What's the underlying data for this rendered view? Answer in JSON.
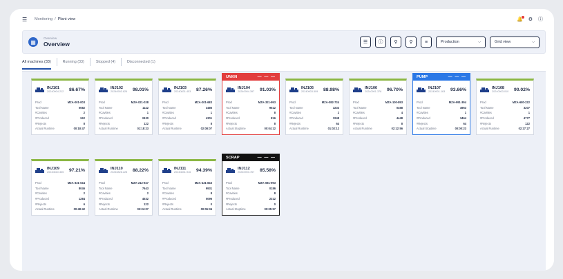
{
  "topbar": {
    "breadcrumb_root": "Monitoring",
    "breadcrumb_sep": "/",
    "breadcrumb_current": "Plant view"
  },
  "header": {
    "subtitle": "Overview",
    "title": "Overview",
    "mode_select": "Production",
    "view_select": "Grid view"
  },
  "tabs": [
    {
      "label": "All machines (33)"
    },
    {
      "label": "Running (33)"
    },
    {
      "label": "Stopped (4)"
    },
    {
      "label": "Disconnected (1)"
    }
  ],
  "row_labels": {
    "prod": "Prod",
    "tool": "Tool Name",
    "cavities": "#Cavities",
    "produced": "#Produced",
    "rejects": "#Rejects",
    "runtime": "Actual Runtime",
    "stoptime": "Actual Stoptime"
  },
  "machines": [
    {
      "name": "INJ101",
      "date": "20240904.212",
      "pct": "86.67%",
      "prod": "MZA-001-003",
      "tool": "0082",
      "cavities": "2",
      "produced": "242",
      "rejects": "8",
      "time": "00:18:47",
      "alert": "",
      "time_label": "runtime"
    },
    {
      "name": "INJ102",
      "date": "20240903.826",
      "pct": "98.01%",
      "prod": "MZA-021-038",
      "tool": "1142",
      "cavities": "1",
      "produced": "2430",
      "rejects": "122",
      "time": "01:18:23",
      "alert": "",
      "time_label": "runtime"
    },
    {
      "name": "INJ103",
      "date": "20240831.453",
      "pct": "87.26%",
      "prod": "MZA-201-683",
      "tool": "3486",
      "cavities": "1",
      "produced": "4301",
      "rejects": "8",
      "time": "02:08:07",
      "alert": "",
      "time_label": "runtime"
    },
    {
      "name": "INJ104",
      "date": "20240904.397",
      "pct": "91.03%",
      "prod": "MZA-321-993",
      "tool": "9512",
      "cavities": "8",
      "produced": "816",
      "rejects": "8",
      "time": "00:04:12",
      "alert": "UNKN",
      "time_label": "stoptime"
    },
    {
      "name": "INJ105",
      "date": "20240903.509",
      "pct": "88.98%",
      "prod": "MZA-082-734",
      "tool": "3233",
      "cavities": "2",
      "produced": "3248",
      "rejects": "64",
      "time": "01:02:12",
      "alert": "",
      "time_label": "runtime"
    },
    {
      "name": "INJ106",
      "date": "20240901.378",
      "pct": "96.70%",
      "prod": "MZA-100-893",
      "tool": "0468",
      "cavities": "4",
      "produced": "4448",
      "rejects": "8",
      "time": "02:12:56",
      "alert": "",
      "time_label": "runtime"
    },
    {
      "name": "INJ107",
      "date": "20240901.163",
      "pct": "93.66%",
      "prod": "MZA-991-394",
      "tool": "4963",
      "cavities": "1",
      "produced": "3464",
      "rejects": "64",
      "time": "00:00:23",
      "alert": "PUMP",
      "time_label": "stoptime"
    },
    {
      "name": "INJ108",
      "date": "20240903.010",
      "pct": "90.02%",
      "prod": "MZA-680-222",
      "tool": "3207",
      "cavities": "1",
      "produced": "4777",
      "rejects": "122",
      "time": "02:27:27",
      "alert": "",
      "time_label": "runtime"
    },
    {
      "name": "INJ109",
      "date": "20240810.335",
      "pct": "97.21%",
      "prod": "MZA-331-044",
      "tool": "8046",
      "cavities": "2",
      "produced": "1284",
      "rejects": "6",
      "time": "00:48:42",
      "alert": "",
      "time_label": "runtime"
    },
    {
      "name": "INJ110",
      "date": "20240828.228",
      "pct": "88.22%",
      "prod": "MZA-212-947",
      "tool": "7643",
      "cavities": "2",
      "produced": "4532",
      "rejects": "122",
      "time": "02:24:07",
      "alert": "",
      "time_label": "runtime"
    },
    {
      "name": "INJ111",
      "date": "20240831.916",
      "pct": "94.39%",
      "prod": "MZA-431-843",
      "tool": "9931",
      "cavities": "8",
      "produced": "0096",
      "rejects": "0",
      "time": "00:06:34",
      "alert": "",
      "time_label": "runtime"
    },
    {
      "name": "INJ112",
      "date": "20240903.767",
      "pct": "85.58%",
      "prod": "MZA-081-993",
      "tool": "0186",
      "cavities": "8",
      "produced": "2312",
      "rejects": "0",
      "time": "00:05:57",
      "alert": "SCRAP",
      "time_label": "stoptime"
    }
  ],
  "colors": {
    "running": "#8ab642",
    "alert_red": "#e23d3d",
    "alert_blue": "#2b78e6",
    "alert_black": "#111111",
    "accent": "#1f4fa8"
  }
}
